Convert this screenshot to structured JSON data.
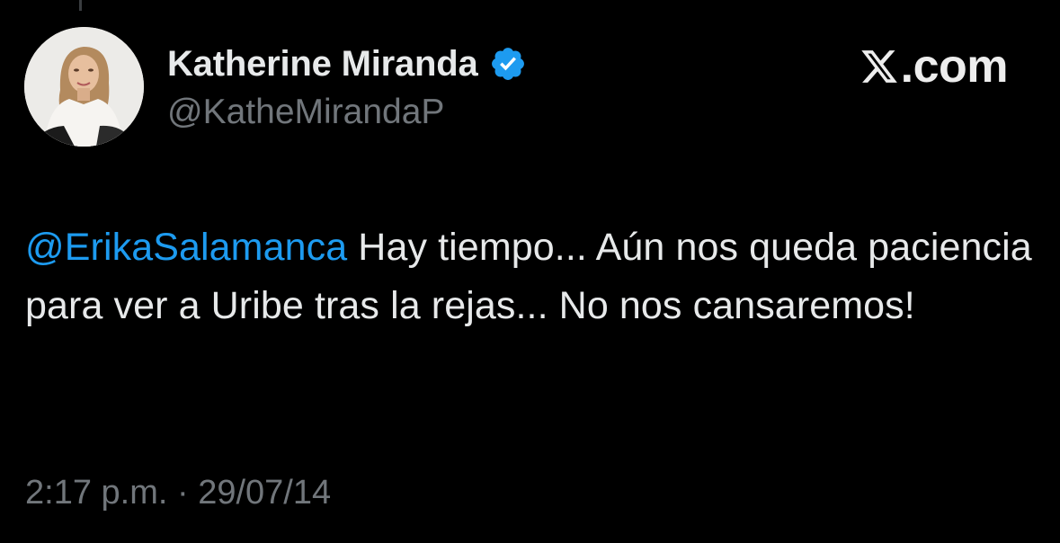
{
  "colors": {
    "background": "#000000",
    "text_primary": "#e7e9ea",
    "text_secondary": "#71767b",
    "accent": "#1d9bf0"
  },
  "author": {
    "display_name": "Katherine Miranda",
    "handle": "@KatheMirandaP",
    "verified_icon": "verified-badge-icon",
    "avatar_icon": "profile-photo"
  },
  "brand": {
    "domain_suffix": ".com",
    "logo_icon": "x-logo-icon"
  },
  "tweet": {
    "mention": "@ErikaSalamanca",
    "body": " Hay tiempo... Aún nos queda paciencia para ver a Uribe tras la rejas... No nos cansaremos!"
  },
  "meta": {
    "time": "2:17 p.m.",
    "separator": " · ",
    "date": "29/07/14"
  }
}
